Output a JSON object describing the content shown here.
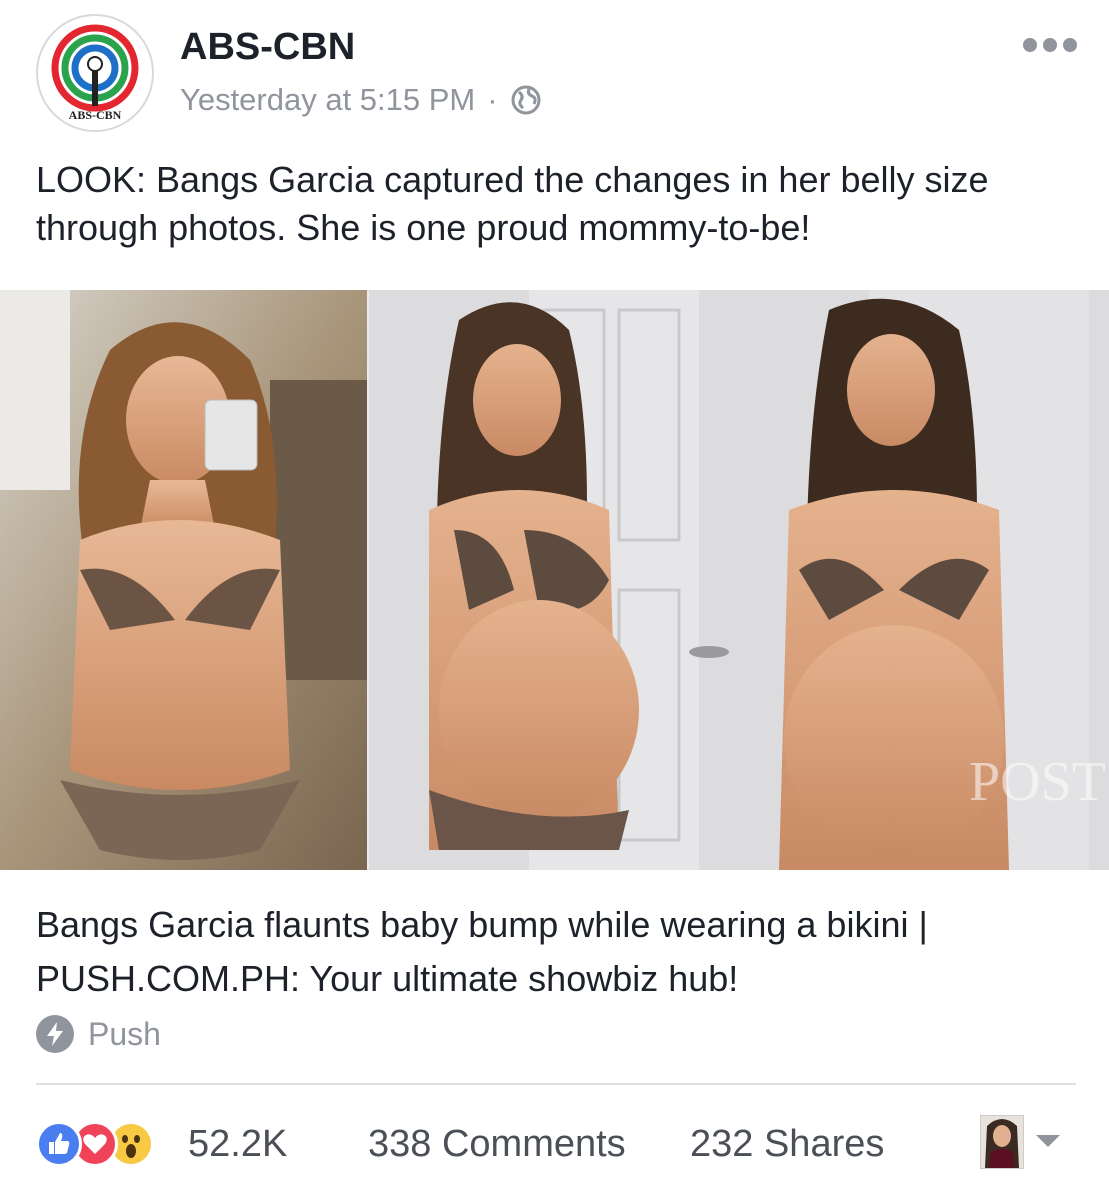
{
  "post": {
    "author": "ABS-CBN",
    "timestamp": "Yesterday at 5:15 PM",
    "separator": "·",
    "audience_icon": "globe-icon",
    "avatar_logo_text": "ABS-CBN",
    "text": "LOOK: Bangs Garcia captured the changes in her belly size through photos. She is one proud mommy-to-be!"
  },
  "media": {
    "watermark": "POST"
  },
  "link": {
    "title": "Bangs Garcia flaunts baby bump while wearing a bikini | PUSH.COM.PH: Your ultimate showbiz hub!",
    "source": "Push",
    "source_icon": "lightning-bolt-icon"
  },
  "footer": {
    "reactions": [
      "like-reaction-icon",
      "love-reaction-icon",
      "wow-reaction-icon"
    ],
    "reaction_count": "52.2K",
    "comments": "338 Comments",
    "shares": "232 Shares"
  },
  "colors": {
    "like_blue": "#4a7ef0",
    "love_red": "#f0435a",
    "wow_yellow": "#f7c944",
    "secondary_text": "#90949c"
  }
}
